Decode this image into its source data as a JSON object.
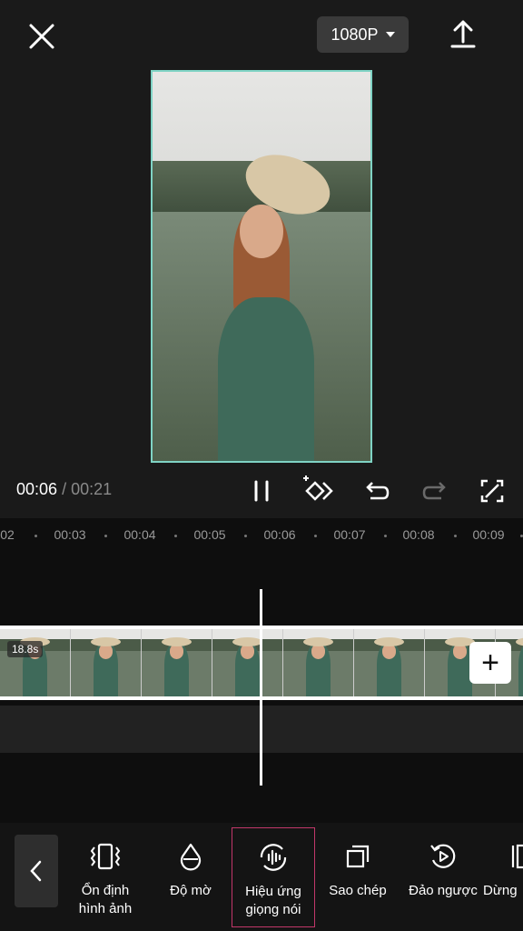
{
  "topbar": {
    "resolution_label": "1080P"
  },
  "playback": {
    "current_time": "00:06",
    "separator": "/",
    "total_time": "00:21"
  },
  "ruler": {
    "ticks": [
      "02",
      "00:03",
      "00:04",
      "00:05",
      "00:06",
      "00:07",
      "00:08",
      "00:09"
    ]
  },
  "clip": {
    "duration_label": "18.8s",
    "add_label": "+"
  },
  "toolbar": {
    "items": [
      {
        "label_line1": "Ổn định",
        "label_line2": "hình ảnh",
        "icon": "stabilize-icon"
      },
      {
        "label_line1": "Độ mờ",
        "label_line2": "",
        "icon": "blur-drop-icon"
      },
      {
        "label_line1": "Hiệu ứng",
        "label_line2": "giọng nói",
        "icon": "voice-effect-icon"
      },
      {
        "label_line1": "Sao chép",
        "label_line2": "",
        "icon": "copy-icon"
      },
      {
        "label_line1": "Đảo ngược",
        "label_line2": "",
        "icon": "reverse-icon"
      },
      {
        "label_line1": "Dừng",
        "label_line2": "",
        "icon": "freeze-icon"
      }
    ]
  },
  "colors": {
    "preview_border": "#7fd3c4",
    "selected_tool_border": "#c2376a"
  }
}
